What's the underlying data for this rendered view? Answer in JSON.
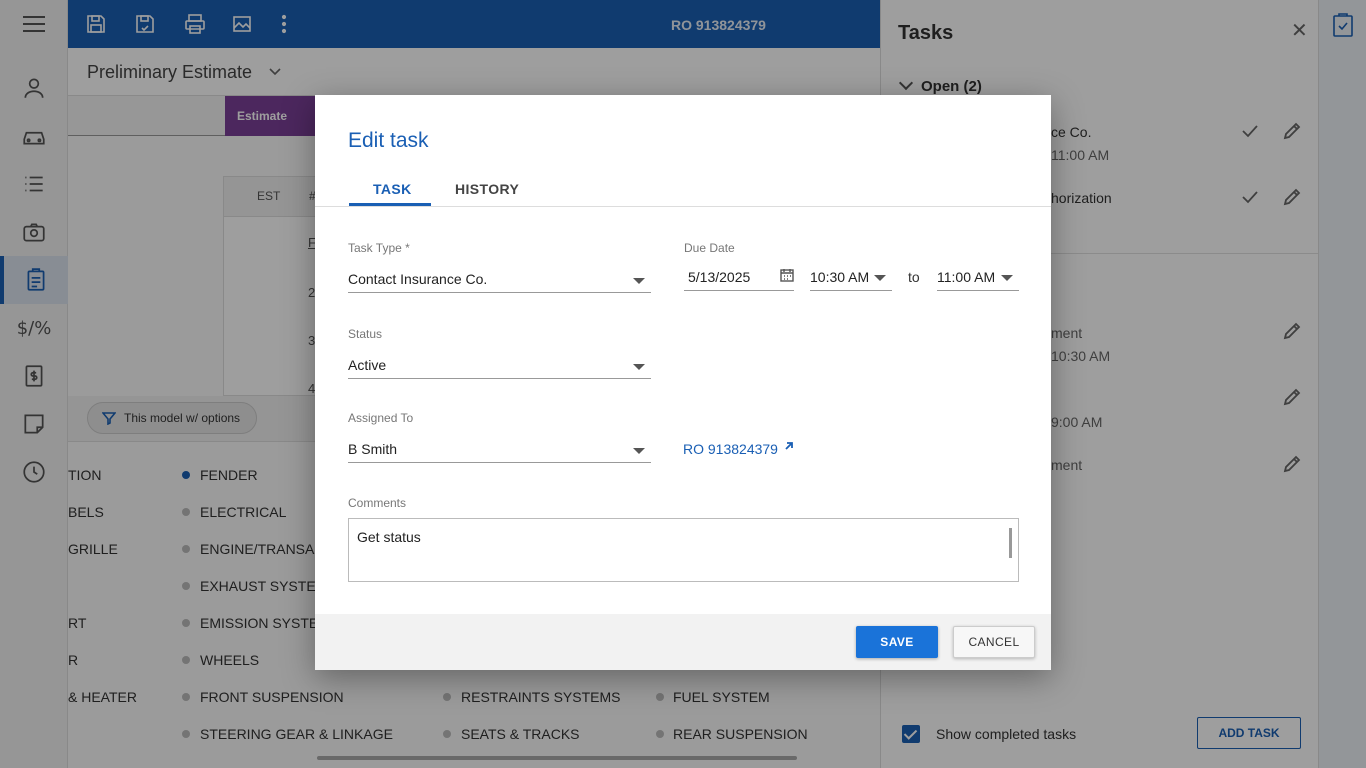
{
  "topbar": {
    "ro_number": "RO 913824379"
  },
  "subheader": {
    "title": "Preliminary Estimate",
    "active_tab": "Estimate"
  },
  "estimate_table": {
    "col_est": "EST",
    "col_num": "#",
    "row_numbers": [
      "F",
      "2",
      "3",
      "4"
    ]
  },
  "filter": {
    "chip_label": "This model w/ options"
  },
  "categories": {
    "col0": [
      "TION",
      "BELS",
      "GRILLE",
      "",
      "RT",
      "R",
      "& HEATER"
    ],
    "col1": [
      "FENDER",
      "ELECTRICAL",
      "ENGINE/TRANSAX",
      "EXHAUST SYSTEM",
      "EMISSION SYSTEM",
      "WHEELS",
      "FRONT SUSPENSION",
      "STEERING GEAR & LINKAGE"
    ],
    "col2": [
      "RESTRAINTS SYSTEMS",
      "SEATS & TRACKS"
    ],
    "col3": [
      "FUEL SYSTEM",
      "REAR SUSPENSION"
    ]
  },
  "tasks_panel": {
    "title": "Tasks",
    "open_header": "Open (2)",
    "items": [
      {
        "text": "ce Co.",
        "sub": "11:00 AM"
      },
      {
        "text": "horization",
        "sub": ""
      },
      {
        "text": "ment",
        "sub": "10:30 AM"
      },
      {
        "text": "",
        "sub": "9:00 AM"
      },
      {
        "text": "ment",
        "sub": ""
      }
    ],
    "show_completed_label": "Show completed tasks",
    "add_task_label": "ADD TASK"
  },
  "dialog": {
    "title": "Edit task",
    "tabs": [
      "TASK",
      "HISTORY"
    ],
    "task_type_label": "Task Type *",
    "task_type_value": "Contact Insurance Co.",
    "due_date_label": "Due Date",
    "due_date_value": "5/13/2025",
    "time_from": "10:30 AM",
    "to_label": "to",
    "time_to": "11:00 AM",
    "status_label": "Status",
    "status_value": "Active",
    "assigned_label": "Assigned To",
    "assigned_value": "B Smith",
    "ro_link": "RO 913824379",
    "comments_label": "Comments",
    "comments_value": "Get status",
    "save_label": "SAVE",
    "cancel_label": "CANCEL"
  },
  "colors": {
    "primary": "#1a5fb4",
    "estimate_tab": "#7b3f98",
    "save_button": "#1a73d9"
  }
}
